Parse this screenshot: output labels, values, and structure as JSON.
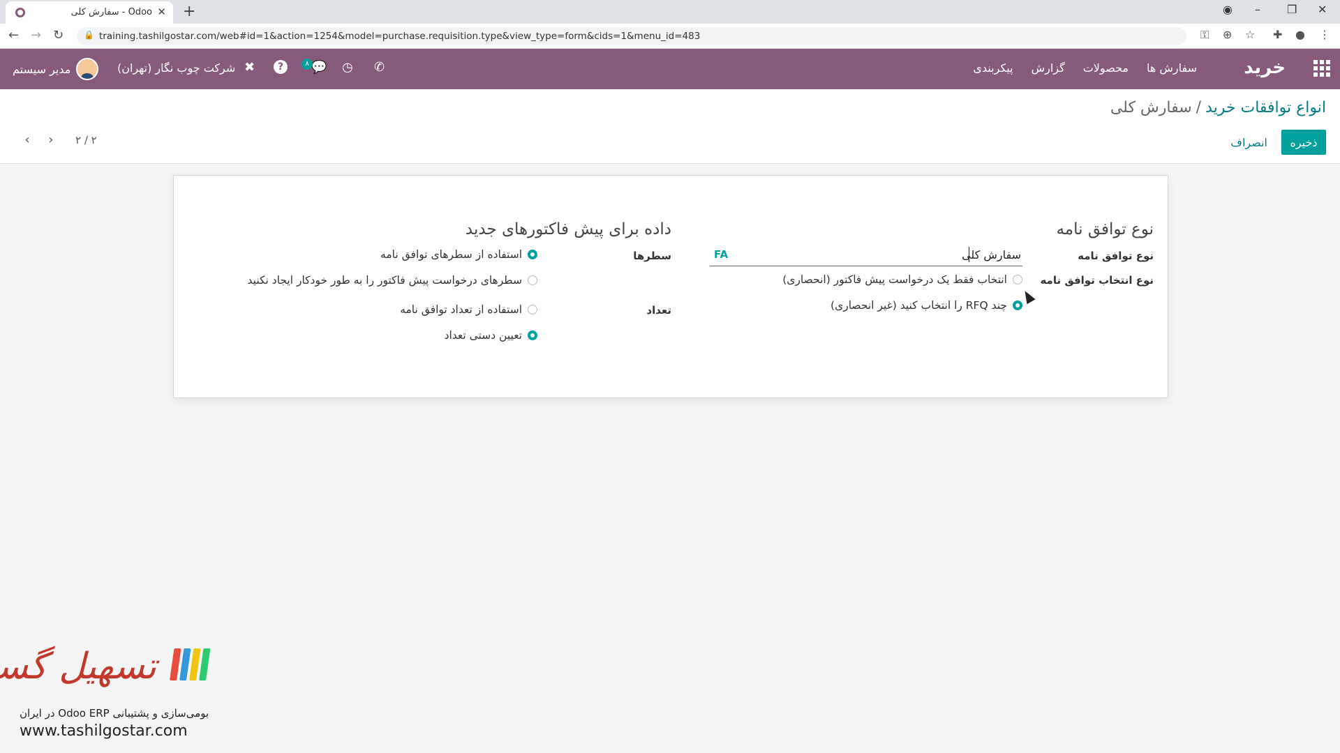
{
  "browser": {
    "tab_title": "سفارش کلی - Odoo",
    "url": "training.tashilgostar.com/web#id=1&action=1254&model=purchase.requisition.type&view_type=form&cids=1&menu_id=483"
  },
  "navbar": {
    "app_name": "خرید",
    "menu": [
      "سفارش ها",
      "محصولات",
      "گزارش",
      "پیکربندی"
    ],
    "company": "شرکت چوب نگار (تهران)",
    "user": "مدیر سیستم",
    "chat_badge": "۸"
  },
  "control_panel": {
    "breadcrumb_parent": "انواع توافقات خرید",
    "breadcrumb_sep": "/",
    "breadcrumb_current": "سفارش کلی",
    "save_label": "ذخیره",
    "discard_label": "انصراف",
    "pager": "۲ / ۲"
  },
  "form": {
    "group_agreement": {
      "title": "نوع توافق نامه",
      "name_label": "نوع توافق نامه",
      "name_value": "سفارش کلی",
      "lang_tag": "FA",
      "selection_label": "نوع انتخاب توافق نامه",
      "selection_options": [
        {
          "label": "انتخاب فقط یک درخواست پیش فاکتور (انحصاری)",
          "checked": false
        },
        {
          "label": "چند RFQ را انتخاب کنید (غیر انحصاری)",
          "checked": true
        }
      ]
    },
    "group_rfq": {
      "title": "داده برای پیش فاکتورهای جدید",
      "lines_label": "سطرها",
      "lines_options": [
        {
          "label": "استفاده از سطرهای توافق نامه",
          "checked": true
        },
        {
          "label": "سطرهای درخواست پیش فاکتور را به طور خودکار ایجاد نکنید",
          "checked": false
        }
      ],
      "quantity_label": "تعداد",
      "quantity_options": [
        {
          "label": "استفاده از تعداد توافق نامه",
          "checked": false
        },
        {
          "label": "تعیین دستی تعداد",
          "checked": true
        }
      ]
    }
  },
  "watermark": {
    "brand": "تسهیل گستر",
    "tagline": "بومی‌سازی و پشتیبانی Odoo ERP در ایران",
    "url": "www.tashilgostar.com"
  },
  "colors": {
    "navbar": "#875a7b",
    "accent": "#00a09d",
    "link": "#017e84"
  }
}
